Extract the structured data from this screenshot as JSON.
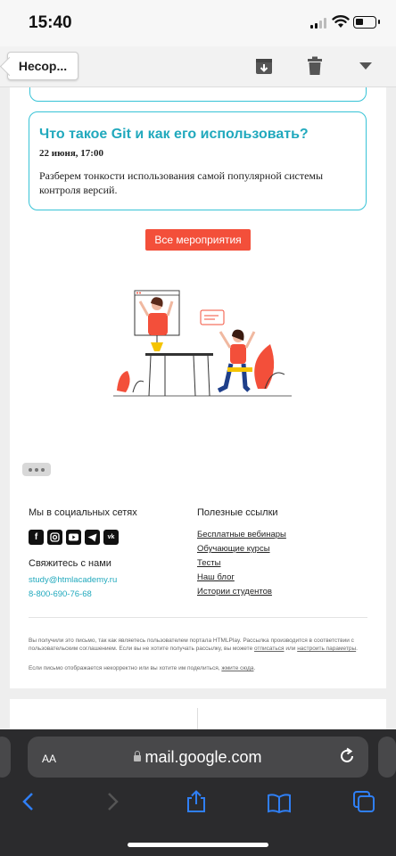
{
  "status": {
    "time": "15:40"
  },
  "toolbar": {
    "back_label": "Несор..."
  },
  "email": {
    "event": {
      "title": "Что такое Git и как его использовать?",
      "date": "22 июня, 17:00",
      "description": "Разберем тонкости использования самой популярной системы контроля версий."
    },
    "events_button": "Все мероприятия",
    "footer": {
      "social_title": "Мы в социальных сетях",
      "social_icons": [
        "facebook-icon",
        "instagram-icon",
        "youtube-icon",
        "telegram-icon",
        "vk-icon"
      ],
      "contact_title": "Свяжитесь с нами",
      "email": "study@htmlacademy.ru",
      "phone": "8-800-690-76-68",
      "links_title": "Полезные ссылки",
      "links": [
        "Бесплатные вебинары",
        "Обучающие курсы",
        "Тесты",
        "Наш блог",
        "Истории студентов"
      ],
      "fine_print_1": "Вы получили это письмо, так как являетесь пользователем портала HTMLPlay. Рассылка производится в соответствии с пользовательским соглашением. Если вы не хотите получать рассылку, вы можете",
      "unsubscribe_link": "отписаться",
      "fine_or": "или",
      "settings_link": "настроить параметры",
      "fine_print_2": "Если письмо отображается некорректно или вы хотите им поделиться,",
      "view_link": "жмите сюда"
    }
  },
  "safari": {
    "text_size": "AA",
    "url": "mail.google.com"
  },
  "colors": {
    "accent": "#21a9bd",
    "button": "#f34f3a",
    "safari_bg": "#2b2b2d",
    "ios_blue": "#2f7ff5"
  }
}
